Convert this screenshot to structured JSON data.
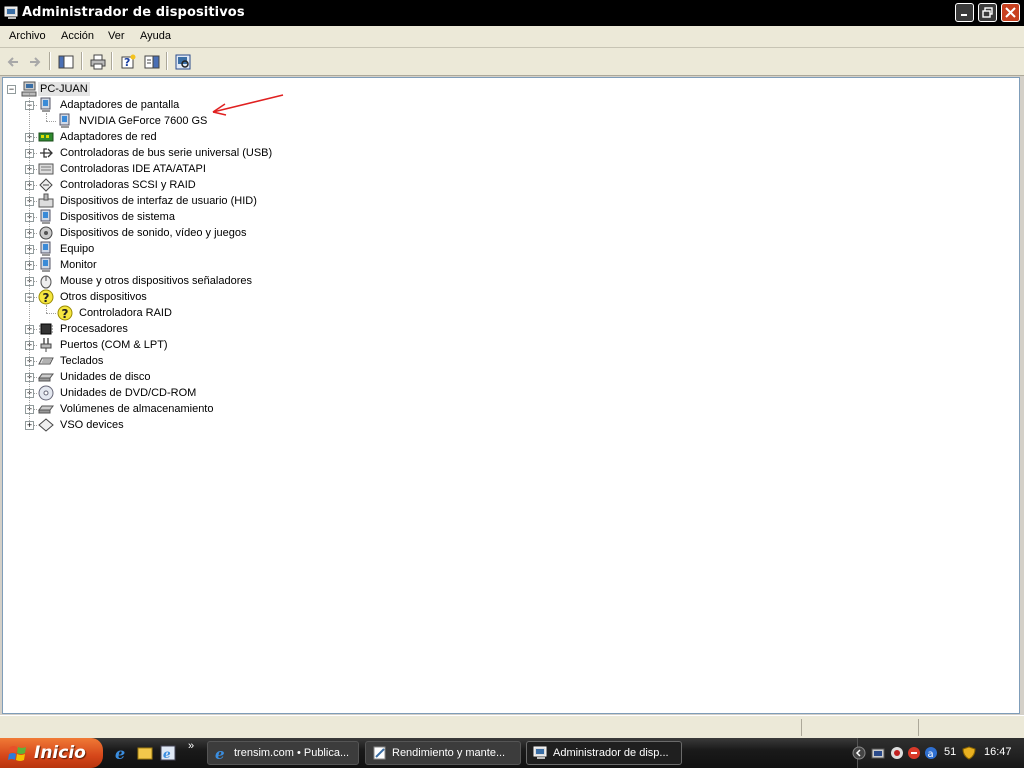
{
  "window": {
    "title": "Administrador de dispositivos"
  },
  "menu": [
    "Archivo",
    "Acción",
    "Ver",
    "Ayuda"
  ],
  "toolbar": {
    "buttons": [
      "back-icon",
      "forward-icon",
      "console-tree-icon",
      "print-icon",
      "help-icon",
      "properties-icon",
      "scan-hardware-icon"
    ]
  },
  "tree": {
    "root": "PC-JUAN",
    "categories": [
      {
        "label": "Adaptadores de pantalla",
        "icon": "display-adapter-icon",
        "expanded": true,
        "children": [
          "NVIDIA GeForce 7600 GS"
        ]
      },
      {
        "label": "Adaptadores de red",
        "icon": "network-adapter-icon"
      },
      {
        "label": "Controladoras de bus serie universal (USB)",
        "icon": "usb-icon"
      },
      {
        "label": "Controladoras IDE ATA/ATAPI",
        "icon": "ide-icon"
      },
      {
        "label": "Controladoras SCSI y RAID",
        "icon": "scsi-icon"
      },
      {
        "label": "Dispositivos de interfaz de usuario (HID)",
        "icon": "hid-icon"
      },
      {
        "label": "Dispositivos de sistema",
        "icon": "system-icon"
      },
      {
        "label": "Dispositivos de sonido, vídeo y juegos",
        "icon": "sound-icon"
      },
      {
        "label": "Equipo",
        "icon": "computer-icon"
      },
      {
        "label": "Monitor",
        "icon": "monitor-icon"
      },
      {
        "label": "Mouse y otros dispositivos señaladores",
        "icon": "mouse-icon"
      },
      {
        "label": "Otros dispositivos",
        "icon": "unknown-device-icon",
        "expanded": true,
        "children": [
          "Controladora RAID"
        ]
      },
      {
        "label": "Procesadores",
        "icon": "processor-icon"
      },
      {
        "label": "Puertos (COM & LPT)",
        "icon": "port-icon"
      },
      {
        "label": "Teclados",
        "icon": "keyboard-icon"
      },
      {
        "label": "Unidades de disco",
        "icon": "disk-icon"
      },
      {
        "label": "Unidades de DVD/CD-ROM",
        "icon": "dvd-icon"
      },
      {
        "label": "Volúmenes de almacenamiento",
        "icon": "volume-icon"
      },
      {
        "label": "VSO devices",
        "icon": "vso-icon"
      }
    ]
  },
  "taskbar": {
    "start": "Inicio",
    "tasks": [
      {
        "label": "trensim.com • Publica...",
        "active": false
      },
      {
        "label": "Rendimiento y mante...",
        "active": false
      },
      {
        "label": "Administrador de disp...",
        "active": true
      }
    ],
    "tray_number": "51",
    "clock": "16:47"
  },
  "colors": {
    "annotation_arrow": "#e02020",
    "title_bar": "#000000",
    "start_button": "#d5461a",
    "close_button": "#c8401f"
  }
}
